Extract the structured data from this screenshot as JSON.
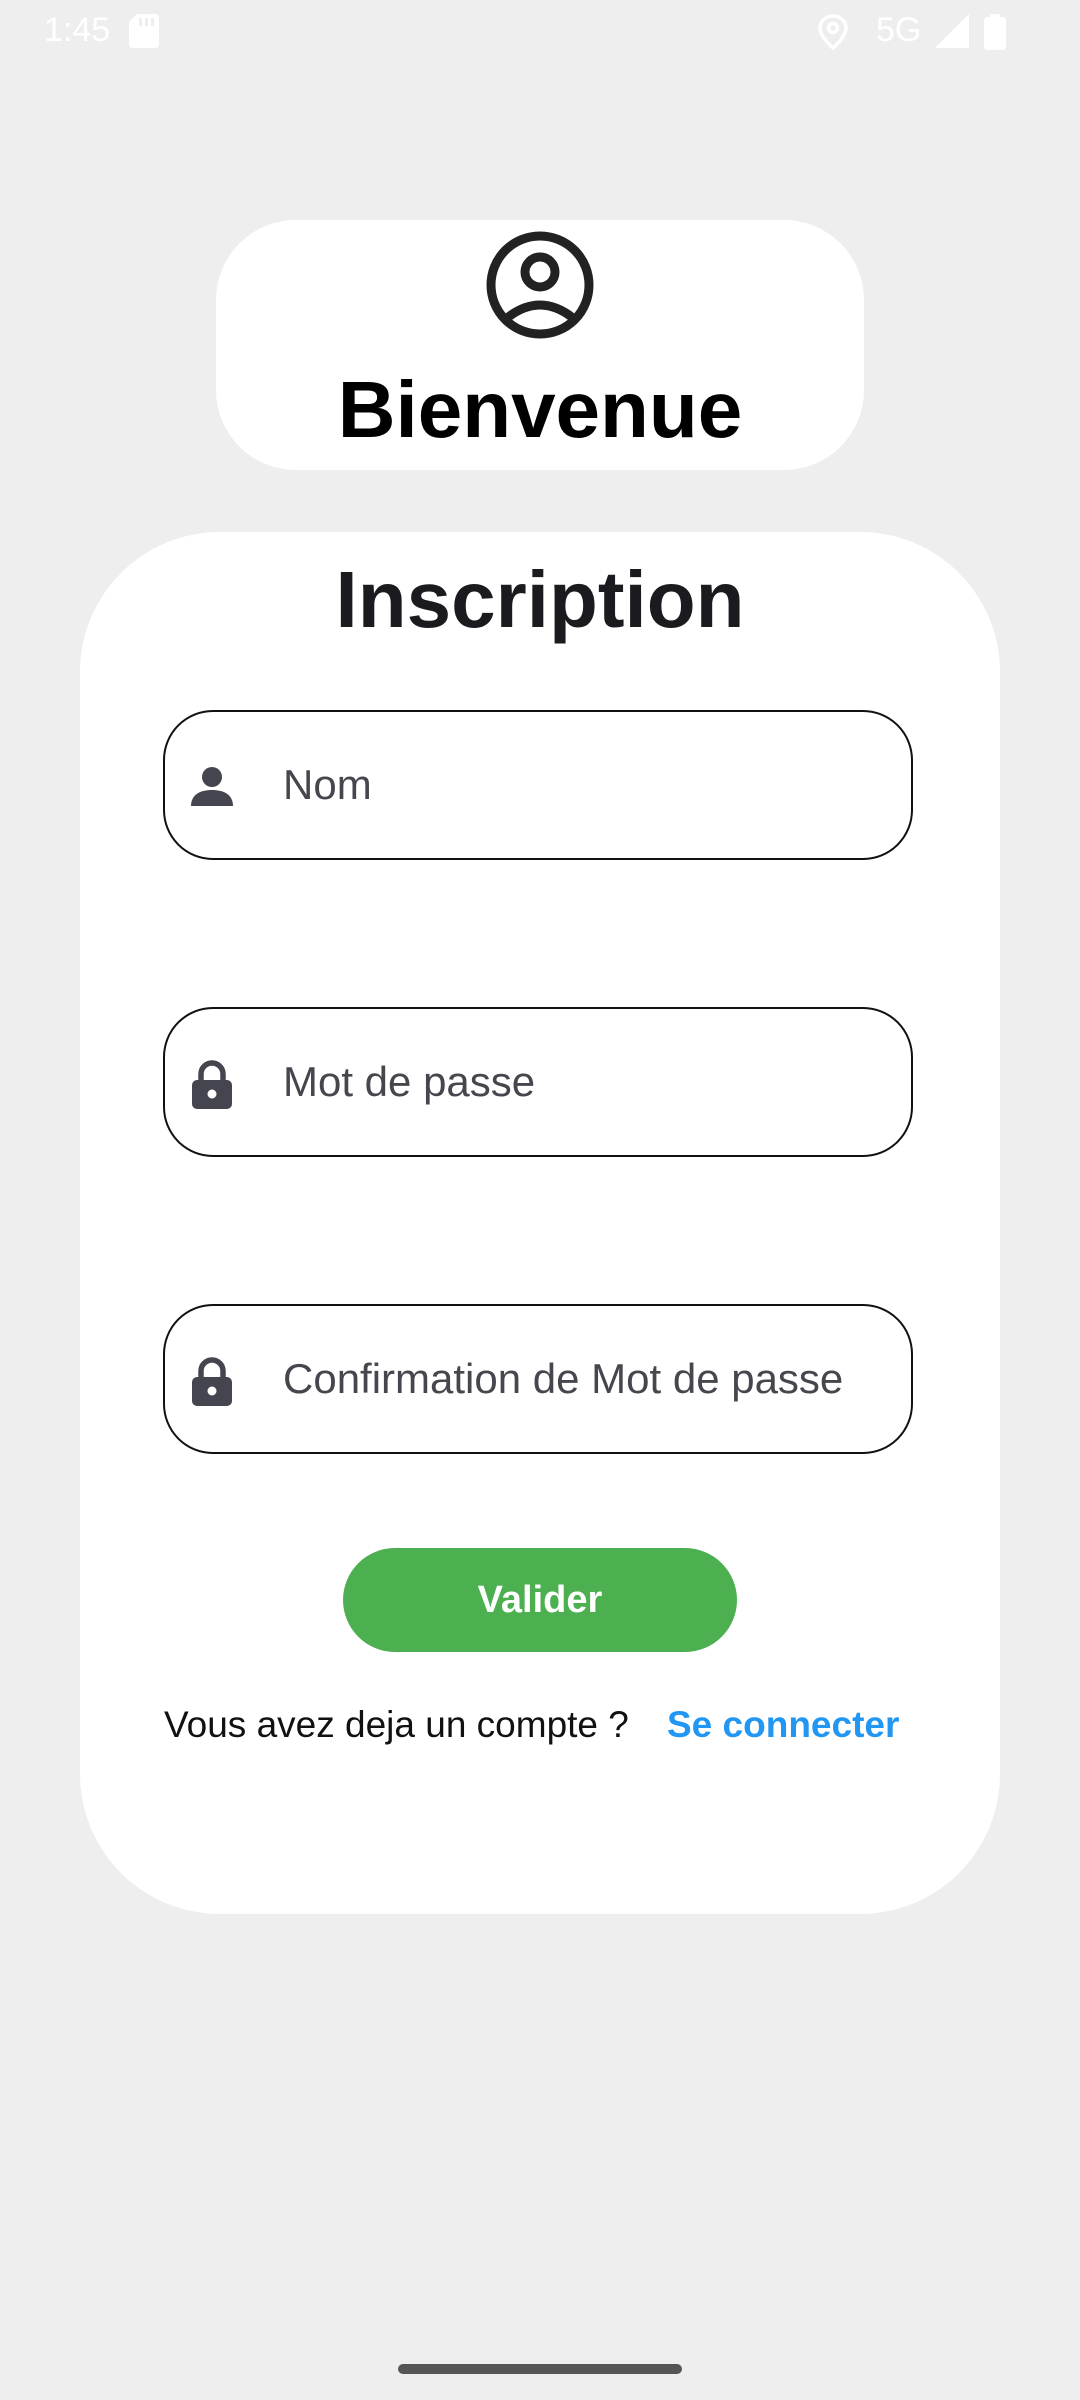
{
  "status_bar": {
    "time": "1:45",
    "network": "5G",
    "icons": [
      "sd-card-icon",
      "location-icon",
      "signal-icon",
      "battery-icon"
    ]
  },
  "welcome": {
    "icon": "account-circle-icon",
    "title": "Bienvenue"
  },
  "form": {
    "title": "Inscription",
    "fields": [
      {
        "icon": "person-icon",
        "placeholder": "Nom",
        "value": ""
      },
      {
        "icon": "lock-icon",
        "placeholder": "Mot de passe",
        "value": ""
      },
      {
        "icon": "lock-icon",
        "placeholder": "Confirmation de Mot de passe",
        "value": ""
      }
    ],
    "submit_label": "Valider",
    "account_prompt": "Vous avez deja un compte ?",
    "login_link": "Se connecter"
  },
  "colors": {
    "background": "#eeeeee",
    "card": "#ffffff",
    "submit_button": "#4caf50",
    "link": "#2196f3"
  }
}
